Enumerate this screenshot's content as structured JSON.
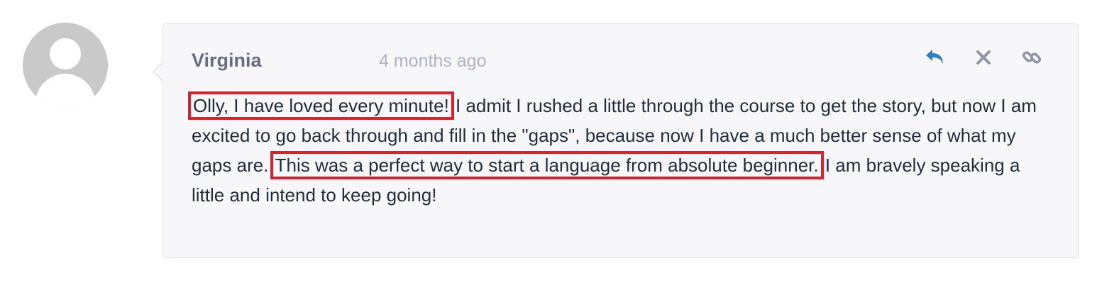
{
  "comment": {
    "author": "Virginia",
    "timestamp": "4 months ago",
    "body": [
      {
        "text": "Olly, I have loved every minute!",
        "highlight": true
      },
      {
        "text": " I admit I rushed a little through the course to get the story, but now I am excited to go back through and fill in the \"gaps\", because now I have a much better sense of what my gaps are. ",
        "highlight": false
      },
      {
        "text": "This was a perfect way to start a language from absolute beginner.",
        "highlight": true
      },
      {
        "text": " I am bravely speaking a little and intend to keep going!",
        "highlight": false
      }
    ]
  },
  "actions": {
    "reply_icon": "reply-icon",
    "close_icon": "close-icon",
    "link_icon": "link-icon"
  },
  "colors": {
    "highlight_border": "#d9202b",
    "reply_icon": "#2f7fc4",
    "muted_icon": "#8f95a8",
    "card_bg": "#f7f7fa",
    "avatar": "#c9c9c9"
  }
}
